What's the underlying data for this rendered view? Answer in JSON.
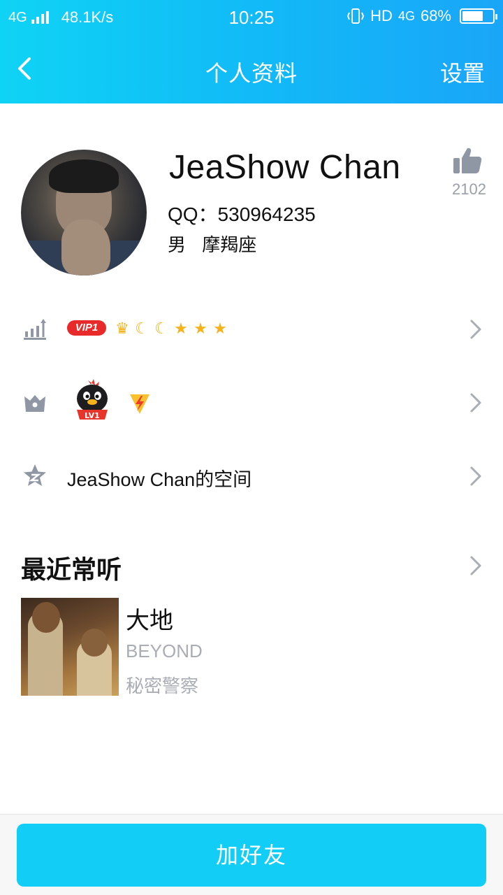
{
  "status_bar": {
    "network_type": "4G",
    "speed": "48.1K/s",
    "time": "10:25",
    "hd": "HD",
    "data_type": "4G",
    "battery": "68%",
    "battery_level": 0.68
  },
  "nav": {
    "back_icon": "back-chevron-icon",
    "title": "个人资料",
    "settings": "设置"
  },
  "profile": {
    "name": "JeaShow Chan",
    "qq": "QQ：530964235",
    "gender": "男",
    "zodiac": "摩羯座",
    "like_count": "2102"
  },
  "rows": {
    "level": {
      "icon": "level-bars-icon",
      "vip_badge": "VIP1",
      "level_icons": [
        "crown-icon",
        "moon-icon",
        "moon-icon",
        "star-icon",
        "star-icon",
        "star-icon"
      ]
    },
    "badges": {
      "icon": "crown-outline-icon",
      "items": [
        "qq-penguin-lv1-icon",
        "lightning-badge-icon"
      ]
    },
    "qzone": {
      "icon": "qzone-star-icon",
      "label": "JeaShow Chan的空间"
    }
  },
  "recent_music": {
    "title": "最近常听",
    "song": {
      "title": "大地",
      "artist": "BEYOND",
      "album": "秘密警察"
    }
  },
  "footer": {
    "add_friend": "加好友"
  },
  "colors": {
    "header_start": "#0fd3f5",
    "header_end": "#1aa6f8",
    "primary_button": "#12cdf5",
    "vip_red": "#e82a2a",
    "muted_text": "#a9adb4"
  }
}
